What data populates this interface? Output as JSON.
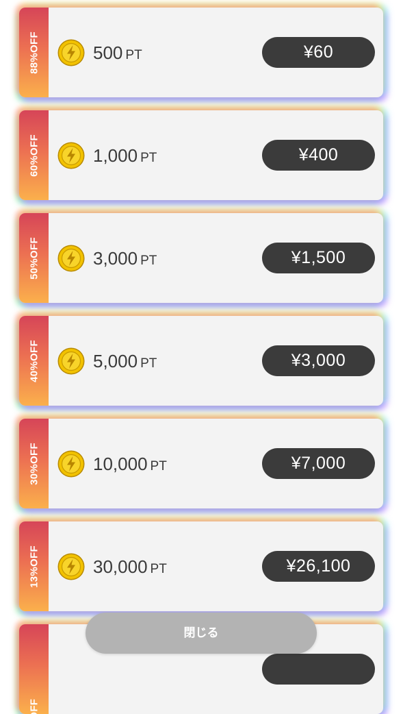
{
  "packages": [
    {
      "discount": "88%OFF",
      "points": "500",
      "unit": "PT",
      "price": "¥60"
    },
    {
      "discount": "60%OFF",
      "points": "1,000",
      "unit": "PT",
      "price": "¥400"
    },
    {
      "discount": "50%OFF",
      "points": "3,000",
      "unit": "PT",
      "price": "¥1,500"
    },
    {
      "discount": "40%OFF",
      "points": "5,000",
      "unit": "PT",
      "price": "¥3,000"
    },
    {
      "discount": "30%OFF",
      "points": "10,000",
      "unit": "PT",
      "price": "¥7,000"
    },
    {
      "discount": "13%OFF",
      "points": "30,000",
      "unit": "PT",
      "price": "¥26,100"
    },
    {
      "discount": "%OFF",
      "points": "",
      "unit": "",
      "price": ""
    }
  ],
  "icons": {
    "coin": "lightning-coin-icon"
  },
  "close_label": "閉じる",
  "colors": {
    "badge_top": "#d64558",
    "badge_bottom": "#fbb04c",
    "price_button": "#3b3b3b",
    "close_button": "#b3b3b3",
    "coin_gold": "#f2c200"
  }
}
